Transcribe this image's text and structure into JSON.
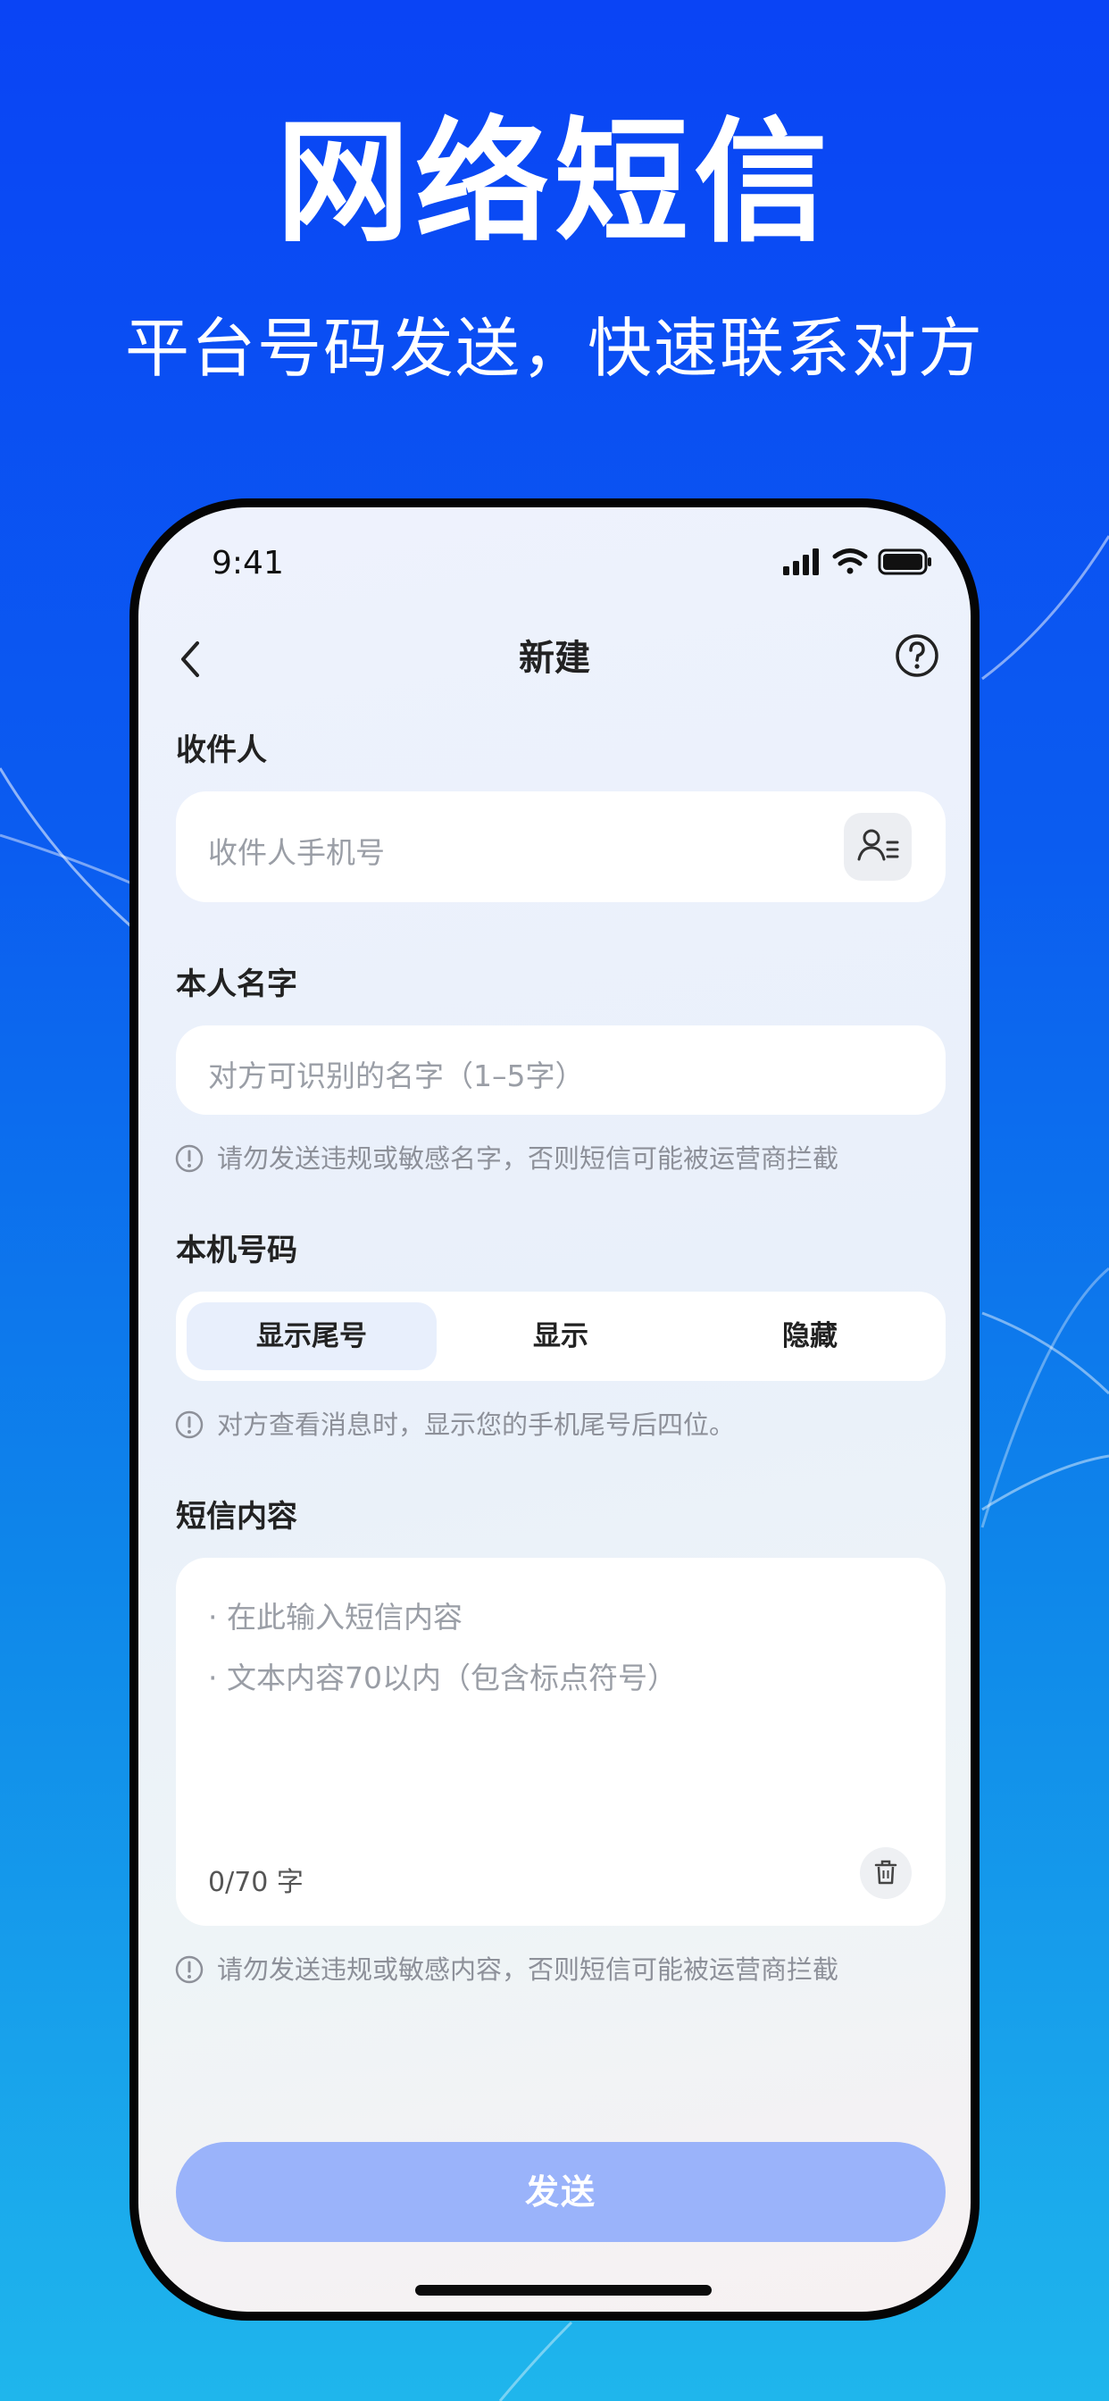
{
  "hero": {
    "title": "网络短信",
    "subtitle": "平台号码发送，快速联系对方"
  },
  "status_bar": {
    "time": "9:41",
    "icons": [
      "signal-icon",
      "wifi-icon",
      "battery-icon"
    ]
  },
  "nav": {
    "title": "新建",
    "back_icon": "chevron-left-icon",
    "help_icon": "question-circle-icon"
  },
  "recipient": {
    "label": "收件人",
    "placeholder": "收件人手机号",
    "contact_icon": "contact-list-icon"
  },
  "name": {
    "label": "本人名字",
    "placeholder": "对方可识别的名字（1–5字）",
    "hint": "请勿发送违规或敏感名字，否则短信可能被运营商拦截"
  },
  "number": {
    "label": "本机号码",
    "options": [
      "显示尾号",
      "显示",
      "隐藏"
    ],
    "selected": "显示尾号",
    "hint": "对方查看消息时，显示您的手机尾号后四位。"
  },
  "content": {
    "label": "短信内容",
    "placeholder_lines": [
      "· 在此输入短信内容",
      "· 文本内容70以内（包含标点符号）"
    ],
    "counter": "0/70 字",
    "hint": "请勿发送违规或敏感内容，否则短信可能被运营商拦截"
  },
  "send_label": "发送",
  "colors": {
    "background_top": "#0a44f5",
    "background_bottom": "#1fb6ec",
    "send_button": "#9ab3fa",
    "segment_active": "#e8effc"
  }
}
